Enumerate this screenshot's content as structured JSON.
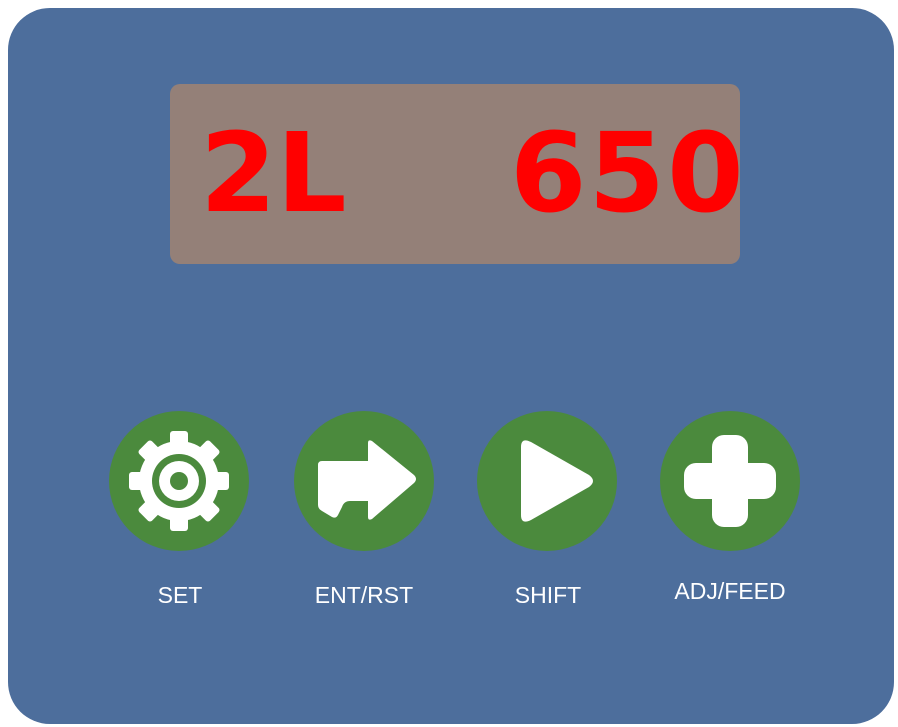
{
  "display": {
    "mode": "2L",
    "value": "650"
  },
  "buttons": [
    {
      "label": "SET",
      "icon": "gear-icon"
    },
    {
      "label": "ENT/RST",
      "icon": "arrow-right-icon"
    },
    {
      "label": "SHIFT",
      "icon": "play-icon"
    },
    {
      "label": "ADJ/FEED",
      "icon": "plus-icon"
    }
  ],
  "colors": {
    "panel": "#4d6e9c",
    "display": "#948078",
    "digits": "#ff0000",
    "button": "#4b8a3d",
    "label": "#ffffff"
  }
}
